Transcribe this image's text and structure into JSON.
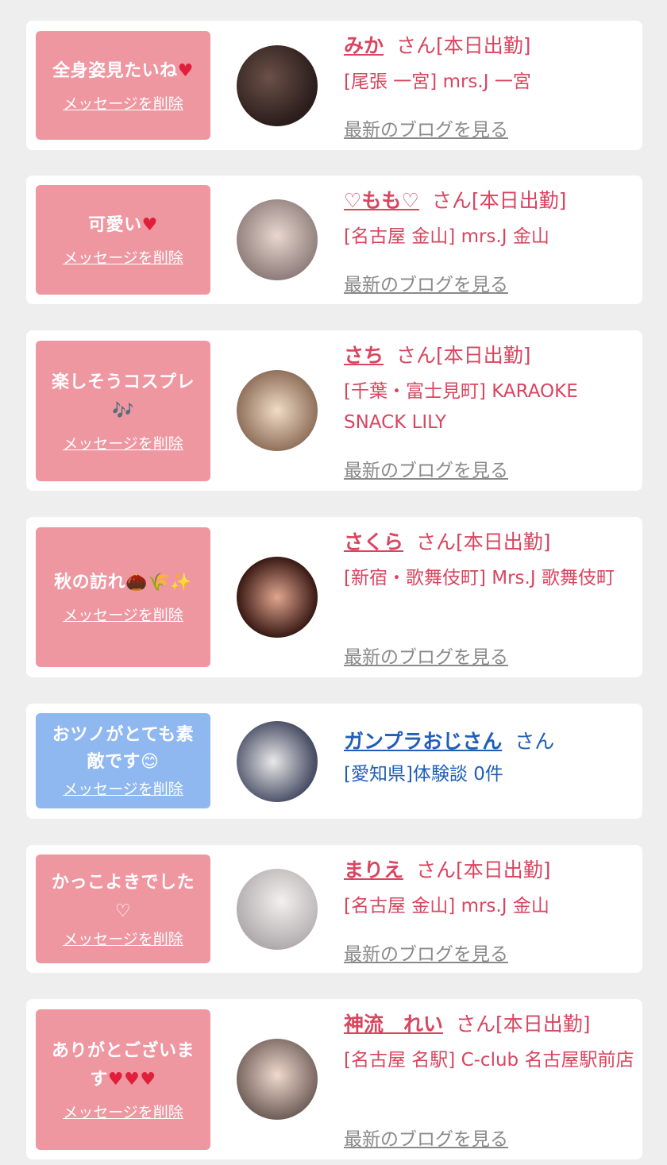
{
  "common": {
    "delete_label": "メッセージを削除",
    "blog_label": "最新のブログを見る",
    "san": "さん"
  },
  "entries": [
    {
      "message": "全身姿見たいね",
      "message_emoji": "♥",
      "name": "みか",
      "status": "[本日出勤]",
      "shop": "[尾張 一宮] mrs.J 一宮",
      "theme": "pink"
    },
    {
      "message": "可愛い",
      "message_emoji": "♥",
      "name": "♡もも♡",
      "status": "[本日出勤]",
      "shop": "[名古屋 金山] mrs.J 金山",
      "theme": "pink"
    },
    {
      "message": "楽しそうコスプレ",
      "message_emoji": "🎶",
      "name": "さち",
      "status": "[本日出勤]",
      "shop": "[千葉・富士見町] KARAOKE SNACK LILY",
      "theme": "pink"
    },
    {
      "message": "秋の訪れ",
      "message_emoji": "🌰🌾✨",
      "name": "さくら",
      "status": "[本日出勤]",
      "shop": "[新宿・歌舞伎町] Mrs.J 歌舞伎町",
      "theme": "pink"
    },
    {
      "message": "おツノがとても素敵です",
      "message_emoji": "😊",
      "name": "ガンプラおじさん",
      "status": "",
      "shop": "[愛知県]体験談 0件",
      "theme": "blue"
    },
    {
      "message": "かっこよきでした",
      "message_emoji": "♡",
      "name": "まりえ",
      "status": "[本日出勤]",
      "shop": "[名古屋 金山] mrs.J 金山",
      "theme": "pink"
    },
    {
      "message": "ありがとございます",
      "message_emoji": "♥♥♥",
      "name": "神流　れい",
      "status": "[本日出勤]",
      "shop": "[名古屋 名駅] C-club 名古屋駅前店",
      "theme": "pink"
    }
  ],
  "colors": {
    "pink_accent": "#d9455f",
    "blue_accent": "#1f5fb5",
    "pink_bubble": "#ee97a1",
    "blue_bubble": "#8fb8f1"
  }
}
